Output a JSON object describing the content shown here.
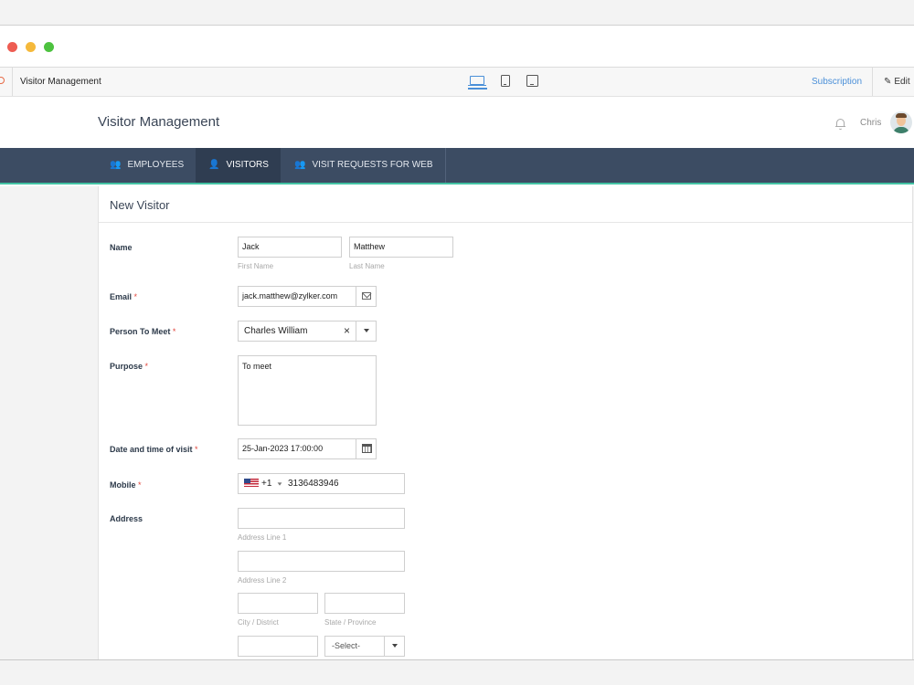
{
  "app_bar": {
    "app_name": "Visitor Management",
    "subscription_label": "Subscription",
    "edit_label": "Edit"
  },
  "header": {
    "title": "Visitor Management",
    "user_name": "Chris"
  },
  "nav": {
    "tabs": [
      {
        "label": "EMPLOYEES",
        "icon": "employees-icon",
        "active": false
      },
      {
        "label": "VISITORS",
        "icon": "visitor-icon",
        "active": true
      },
      {
        "label": "VISIT REQUESTS FOR WEB",
        "icon": "visit-requests-icon",
        "active": false
      }
    ]
  },
  "form": {
    "title": "New Visitor",
    "name": {
      "label": "Name",
      "first_value": "Jack",
      "first_hint": "First Name",
      "last_value": "Matthew",
      "last_hint": "Last Name"
    },
    "email": {
      "label": "Email",
      "value": "jack.matthew@zylker.com",
      "required": "*"
    },
    "person_to_meet": {
      "label": "Person To Meet",
      "value": "Charles William",
      "clear_glyph": "×",
      "required": "*"
    },
    "purpose": {
      "label": "Purpose",
      "value": "To meet",
      "required": "*"
    },
    "visit_datetime": {
      "label": "Date and time of visit",
      "value": "25-Jan-2023 17:00:00",
      "required": "*"
    },
    "mobile": {
      "label": "Mobile",
      "country_code": "+1",
      "value": "3136483946",
      "required": "*"
    },
    "address": {
      "label": "Address",
      "line1_hint": "Address Line 1",
      "line2_hint": "Address Line 2",
      "city_hint": "City / District",
      "state_hint": "State / Province",
      "country_select": "-Select-"
    }
  },
  "colors": {
    "nav_bg": "#3c4c63",
    "nav_active_bg": "#2f3d51",
    "nav_accent": "#43c3a3",
    "link_blue": "#4a8fd8",
    "required_red": "#e2463d"
  }
}
